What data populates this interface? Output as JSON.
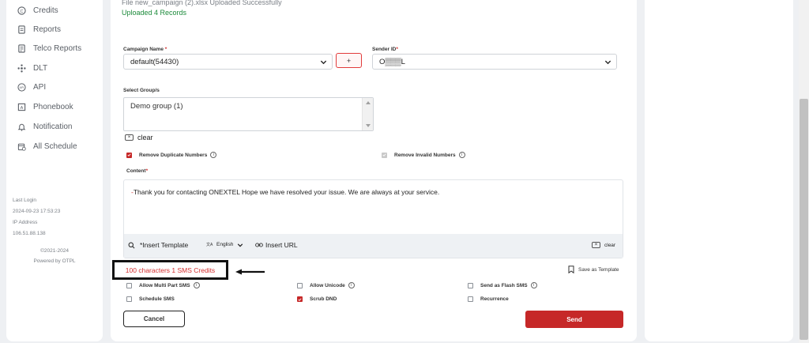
{
  "sidebar": {
    "items": [
      {
        "label": "Credits",
        "icon": "credits-icon"
      },
      {
        "label": "Reports",
        "icon": "reports-icon"
      },
      {
        "label": "Telco Reports",
        "icon": "telco-reports-icon"
      },
      {
        "label": "DLT",
        "icon": "dlt-icon"
      },
      {
        "label": "API",
        "icon": "api-icon"
      },
      {
        "label": "Phonebook",
        "icon": "phonebook-icon"
      },
      {
        "label": "Notification",
        "icon": "bell-icon"
      },
      {
        "label": "All Schedule",
        "icon": "calendar-icon"
      }
    ],
    "last_login_label": "Last Login",
    "last_login_value": "2024-09-23 17:53:23",
    "ip_label": "IP Address",
    "ip_value": "106.51.88.138",
    "copyright": "©2021-2024",
    "powered_by": "Powered by OTPL"
  },
  "upload": {
    "file_message": "File new_campaign (2).xlsx Uploaded Successfully",
    "records_message": "Uploaded 4 Records"
  },
  "form": {
    "campaign_name_label": "Campaign Name",
    "campaign_name_value": "default(54430)",
    "add_label": "+",
    "sender_id_label": "Sender ID",
    "sender_id_value": "O▒▒▒L",
    "groups_label": "Select Group/s",
    "group_value": "Demo group (1)",
    "clear_label": "clear",
    "remove_duplicates_label": "Remove Duplicate Numbers",
    "remove_invalid_label": "Remove Invalid Numbers",
    "content_label": "Content",
    "content_text": "Thank you for contacting ONEXTEL  Hope we have resolved your issue. We are always at your service.",
    "insert_template_label": "*Insert Template",
    "language_label": "English",
    "insert_url_label": "Insert URL",
    "content_clear_label": "clear",
    "credits_text": "100 characters 1 SMS Credits",
    "save_template_label": "Save as Template",
    "options": {
      "multipart": "Allow Multi Part SMS",
      "unicode": "Allow Unicode",
      "flash": "Send as Flash SMS",
      "schedule": "Schedule SMS",
      "scrub_dnd": "Scrub DND",
      "recurrence": "Recurrence"
    },
    "cancel_label": "Cancel",
    "send_label": "Send"
  },
  "colors": {
    "accent": "#c62828",
    "success": "#1b8a3a"
  }
}
